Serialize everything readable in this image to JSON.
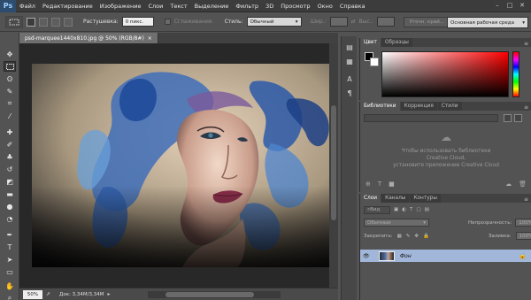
{
  "app": {
    "logo": "Ps"
  },
  "menu": [
    "Файл",
    "Редактирование",
    "Изображение",
    "Слои",
    "Текст",
    "Выделение",
    "Фильтр",
    "3D",
    "Просмотр",
    "Окно",
    "Справка"
  ],
  "window_controls": {
    "minimize": "–",
    "maximize": "□",
    "close": "✕"
  },
  "options": {
    "feather_label": "Растушевка:",
    "feather_value": "0 пикс.",
    "antialias_label": "Сглаживание",
    "style_label": "Стиль:",
    "style_value": "Обычный",
    "width_label": "Шир.:",
    "height_label": "Выс.:",
    "refine_edge": "Уточн. край...",
    "workspace": "Основная рабочая среда"
  },
  "document": {
    "tab_title": "psd-marquee1440x810.jpg @ 50% (RGB/8#)",
    "tab_close": "×",
    "zoom": "50%",
    "info": "Док: 3,34M/3,34M"
  },
  "panels": {
    "color_tabs": [
      "Цвет",
      "Образцы"
    ],
    "library_tabs": [
      "Библиотеки",
      "Коррекция",
      "Стили"
    ],
    "library_message_line1": "Чтобы использовать библиотеки",
    "library_message_line2": "Creative Cloud,",
    "library_message_line3": "установите приложение Creative Cloud",
    "layers_tabs": [
      "Слои",
      "Каналы",
      "Контуры"
    ],
    "kind_label": "Вид",
    "blend_mode": "Обычные",
    "opacity_label": "Непрозрачность:",
    "opacity_value": "100%",
    "lock_label": "Закрепить:",
    "fill_label": "Заливка:",
    "fill_value": "100%",
    "layer_name": "Фон"
  },
  "colors": {
    "foreground": "#000000",
    "background": "#ffffff",
    "selected_layer": "#a1b6d8"
  }
}
